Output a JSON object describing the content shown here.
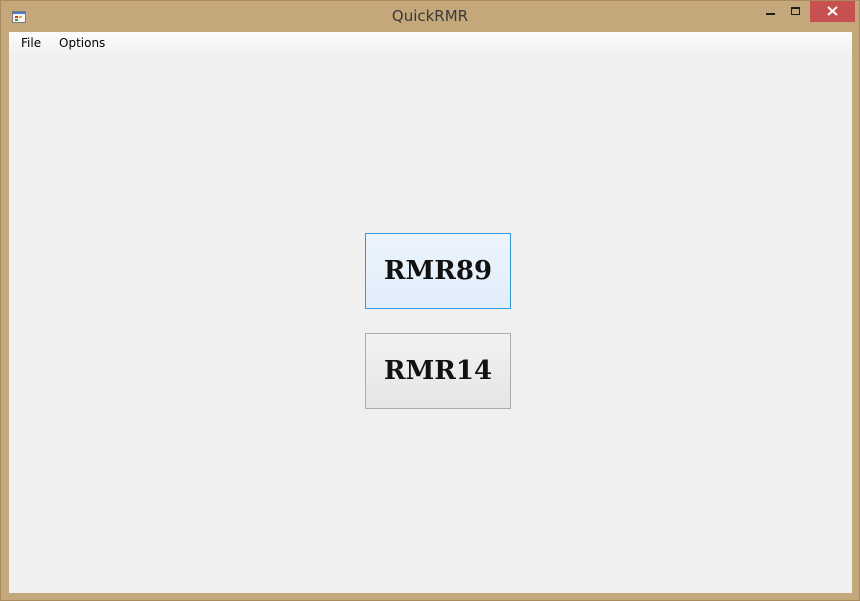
{
  "window": {
    "title": "QuickRMR",
    "colors": {
      "frame": "#c4a77b",
      "close": "#c75050",
      "focus_border": "#3399dd"
    },
    "icons": {
      "app": "app-window-icon",
      "minimize": "minimize-icon",
      "maximize": "maximize-icon",
      "close": "close-icon"
    }
  },
  "menu": {
    "file": "File",
    "options": "Options"
  },
  "buttons": {
    "rmr89": "RMR89",
    "rmr14": "RMR14"
  }
}
